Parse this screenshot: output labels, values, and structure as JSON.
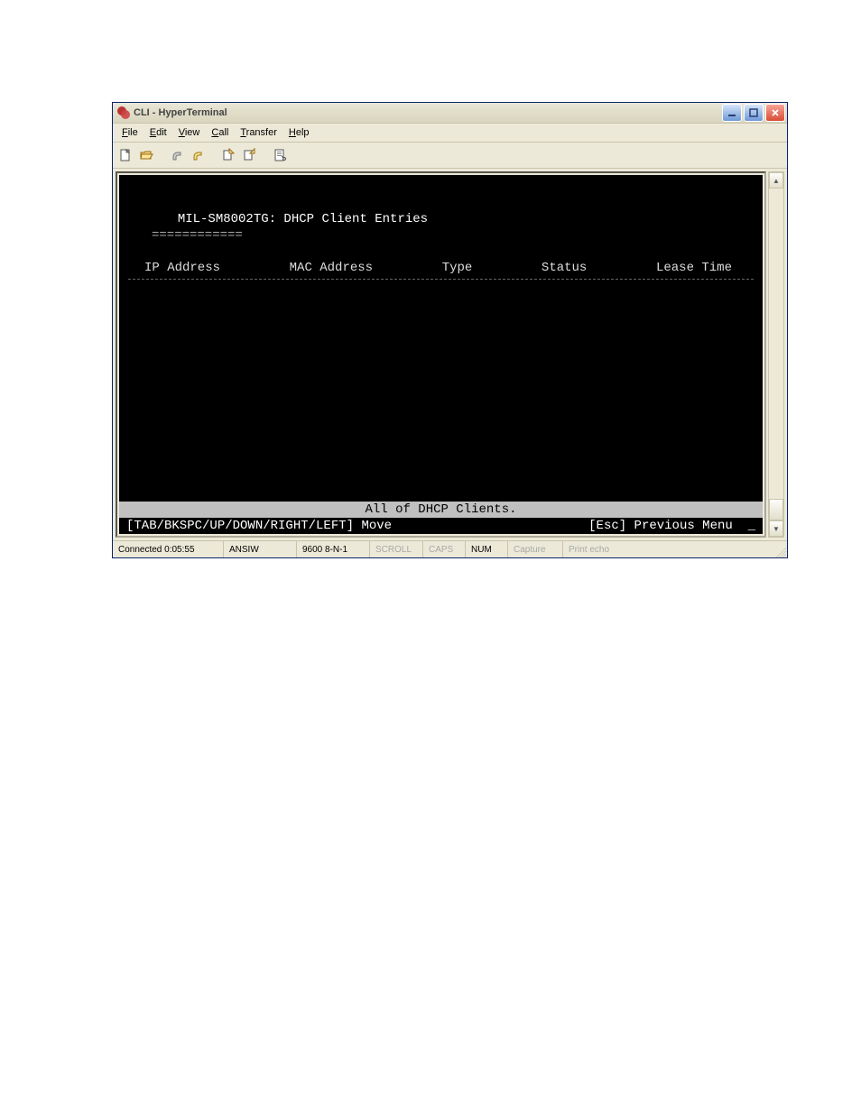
{
  "titlebar": {
    "title": "CLI - HyperTerminal"
  },
  "menus": {
    "file": "File",
    "edit": "Edit",
    "view": "View",
    "call": "Call",
    "transfer": "Transfer",
    "help": "Help"
  },
  "terminal": {
    "header": "MIL-SM8002TG: DHCP Client Entries",
    "underline": "============",
    "columns": {
      "ip": "IP Address",
      "mac": "MAC Address",
      "type": "Type",
      "status": "Status",
      "lease": "Lease Time"
    },
    "footer1": "All of DHCP Clients.",
    "footer2_left": "[TAB/BKSPC/UP/DOWN/RIGHT/LEFT] Move",
    "footer2_right": "[Esc] Previous Menu",
    "cursor": "_"
  },
  "status": {
    "conn": "Connected 0:05:55",
    "emul": "ANSIW",
    "port": "9600 8-N-1",
    "scroll": "SCROLL",
    "caps": "CAPS",
    "num": "NUM",
    "capture": "Capture",
    "echo": "Print echo"
  }
}
